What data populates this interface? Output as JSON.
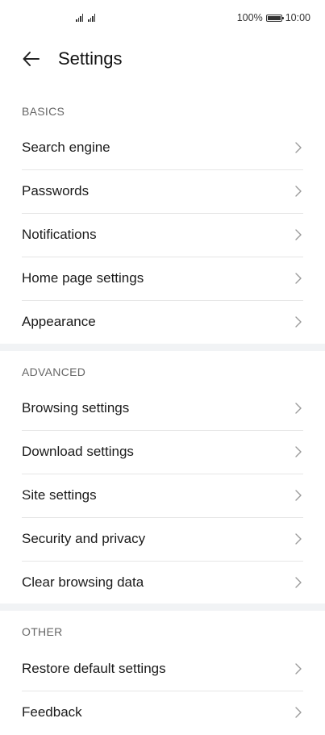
{
  "status_bar": {
    "battery_percent": "100%",
    "battery_level": 1.0,
    "time": "10:00",
    "signal_icon": "signal-icon",
    "battery_icon": "battery-icon"
  },
  "header": {
    "back_icon": "back-arrow-icon",
    "title": "Settings"
  },
  "sections": [
    {
      "header": "BASICS",
      "items": [
        {
          "label": "Search engine"
        },
        {
          "label": "Passwords"
        },
        {
          "label": "Notifications"
        },
        {
          "label": "Home page settings"
        },
        {
          "label": "Appearance"
        }
      ]
    },
    {
      "header": "ADVANCED",
      "items": [
        {
          "label": "Browsing settings"
        },
        {
          "label": "Download settings"
        },
        {
          "label": "Site settings"
        },
        {
          "label": "Security and privacy"
        },
        {
          "label": "Clear browsing data"
        }
      ]
    },
    {
      "header": "OTHER",
      "items": [
        {
          "label": "Restore default settings"
        },
        {
          "label": "Feedback"
        }
      ]
    }
  ],
  "colors": {
    "background": "#ffffff",
    "section_gap": "#f1f3f5",
    "divider": "#e6e6e6",
    "text_primary": "#1b1b1b",
    "text_secondary": "#666666",
    "chevron": "#9a9a9a"
  }
}
